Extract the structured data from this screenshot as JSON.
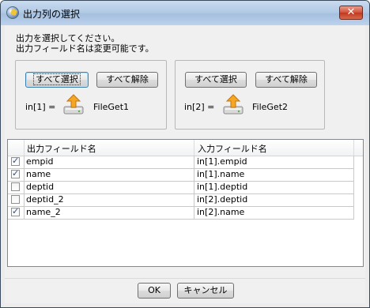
{
  "window": {
    "title": "出力列の選択",
    "close_label": "✕"
  },
  "instructions": {
    "line1": "出力を選択してください。",
    "line2": "出力フィールド名は変更可能です。"
  },
  "inputs": [
    {
      "select_all": "すべて選択",
      "deselect_all": "すべて解除",
      "index_label": "in[1] =",
      "component": "FileGet1"
    },
    {
      "select_all": "すべて選択",
      "deselect_all": "すべて解除",
      "index_label": "in[2] =",
      "component": "FileGet2"
    }
  ],
  "table": {
    "headers": {
      "output": "出力フィールド名",
      "input": "入力フィールド名"
    },
    "rows": [
      {
        "checked": true,
        "output": "empid",
        "input": "in[1].empid"
      },
      {
        "checked": true,
        "output": "name",
        "input": "in[1].name"
      },
      {
        "checked": false,
        "output": "deptid",
        "input": "in[1].deptid"
      },
      {
        "checked": false,
        "output": "deptid_2",
        "input": "in[2].deptid"
      },
      {
        "checked": true,
        "output": "name_2",
        "input": "in[2].name"
      }
    ]
  },
  "footer": {
    "ok": "OK",
    "cancel": "キャンセル"
  }
}
